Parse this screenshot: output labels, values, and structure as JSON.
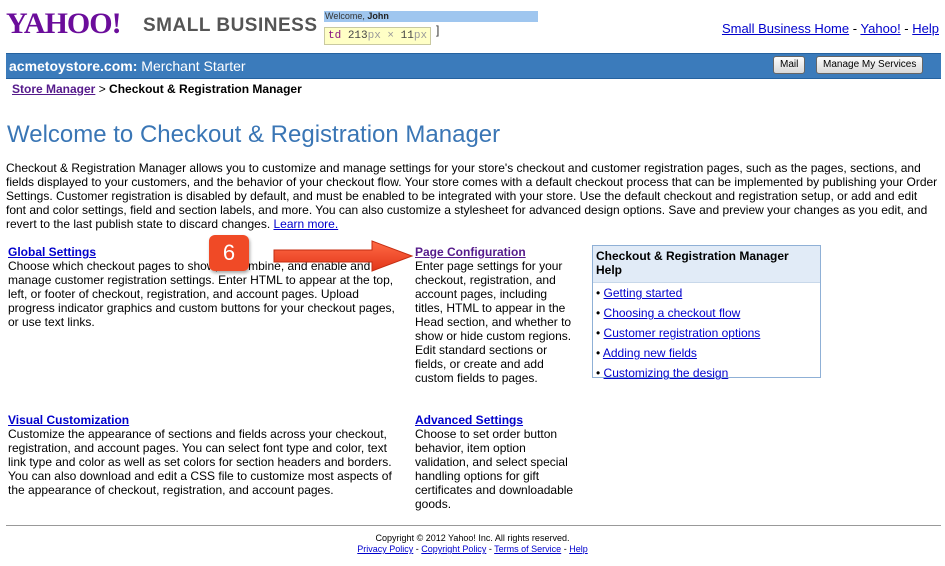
{
  "header": {
    "logo": "YAHOO!",
    "logo_sub": "SMALL BUSINESS",
    "welcome_prefix": "Welcome, ",
    "welcome_name": "John",
    "devtip_tag": "td",
    "devtip_w": "213",
    "devtip_unit1": "px",
    "devtip_x": " × ",
    "devtip_h": "11",
    "devtip_unit2": "px",
    "bracket": "]",
    "links": [
      "Small Business Home",
      "Yahoo!",
      "Help"
    ],
    "sep": " - "
  },
  "bar": {
    "store": "acmetoystore.com:",
    "plan": " Merchant Starter",
    "mail_button": "Mail",
    "services_button": "Manage My Services"
  },
  "breadcrumb": {
    "parent": "Store Manager",
    "sep": " > ",
    "current": "Checkout & Registration Manager"
  },
  "page_title": "Welcome to Checkout & Registration Manager",
  "intro": {
    "text": "Checkout & Registration Manager allows you to customize and manage settings for your store's checkout and customer registration pages, such as the pages, sections, and fields displayed to your customers, and the behavior of your checkout flow. Your store comes with a default checkout process that can be implemented by publishing your Order Settings. Customer registration is disabled by default, and must be enabled to be integrated with your store. Use the default checkout and registration setup, or add and edit font and color settings, field and section labels, and more. You can also customize a stylesheet for advanced design options. Save and preview your changes as you edit, and revert to the last publish state to discard changes. ",
    "learn_more": "Learn more."
  },
  "sections": {
    "global": {
      "title": "Global Settings",
      "text": "Choose which checkout pages to show, or combine, and enable and manage customer registration settings. Enter HTML to appear at the top, left, or footer of checkout, registration, and account pages. Upload progress indicator graphics and custom buttons for your checkout pages, or use text links."
    },
    "page_config": {
      "title": "Page Configuration",
      "text": "Enter page settings for your checkout, registration, and account pages, including titles, HTML to appear in the Head section, and whether to show or hide custom regions. Edit standard sections or fields, or create and add custom fields to pages."
    },
    "visual": {
      "title": "Visual Customization",
      "text": "Customize the appearance of sections and fields across your checkout, registration, and account pages. You can select font type and color, text link type and color as well as set colors for section headers and borders. You can also download and edit a CSS file to customize most aspects of the appearance of checkout, registration, and account pages."
    },
    "advanced": {
      "title": "Advanced Settings",
      "text": "Choose to set order button behavior, item option validation, and select special handling options for gift certificates and downloadable goods."
    }
  },
  "help": {
    "title": "Checkout & Registration Manager Help",
    "bullet": "• ",
    "items": [
      "Getting started",
      "Choosing a checkout flow",
      "Customer registration options",
      "Adding new fields",
      "Customizing the design"
    ]
  },
  "annotation": {
    "step": "6",
    "color": "#f04a26"
  },
  "footer": {
    "copyright": "Copyright © 2012 Yahoo! Inc. All rights reserved.",
    "links": [
      "Privacy Policy",
      "Copyright Policy",
      "Terms of Service",
      "Help"
    ],
    "sep": " - "
  },
  "colors": {
    "brand": "#6b0d9b",
    "bar": "#3b7bbb",
    "title": "#3a76b5",
    "link": "#0000cc"
  }
}
